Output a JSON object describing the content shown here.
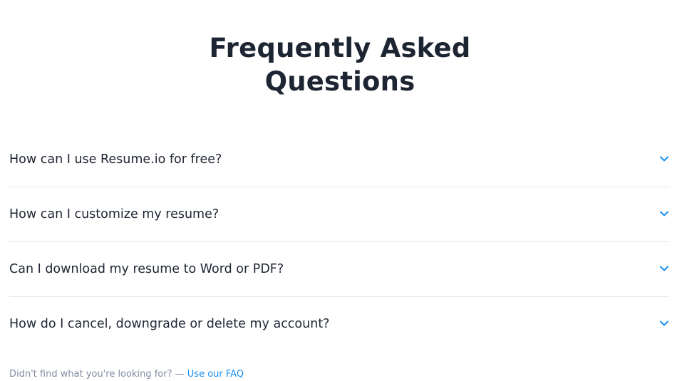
{
  "page": {
    "title": "Frequently Asked Questions",
    "title_line1": "Frequently Asked",
    "title_line2": "Questions"
  },
  "faq": {
    "items": [
      {
        "question": "How can I use Resume.io for free?",
        "icon": "chevron-down-icon"
      },
      {
        "question": "How can I customize my resume?",
        "icon": "chevron-down-icon"
      },
      {
        "question": "Can I download my resume to Word or PDF?",
        "icon": "chevron-down-icon"
      },
      {
        "question": "How do I cancel, downgrade or delete my account?",
        "icon": "chevron-down-icon"
      }
    ]
  },
  "footer": {
    "note": "Didn't find what you're looking for? — ",
    "link_label": "Use our FAQ"
  },
  "colors": {
    "heading": "#1e2532",
    "accent": "#1a91f0",
    "divider": "#e4e7ec",
    "muted": "#828ba2"
  }
}
